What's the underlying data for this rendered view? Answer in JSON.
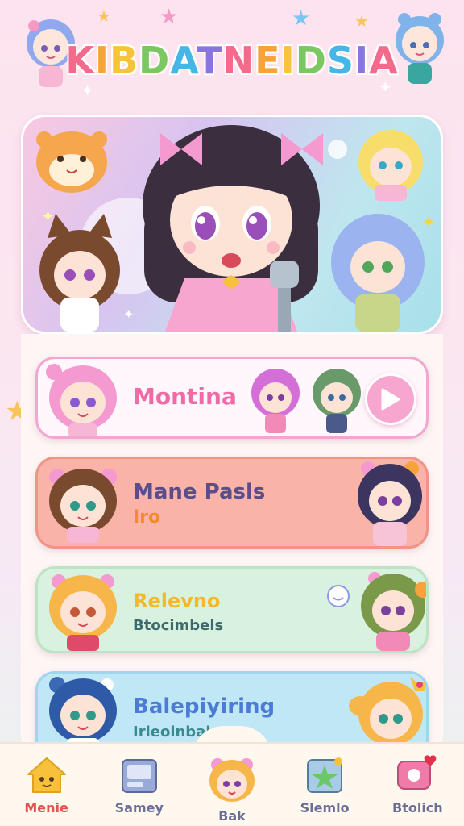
{
  "app": {
    "title_letters": [
      "K",
      "I",
      "B",
      "D",
      "A",
      "T",
      "N",
      "E",
      "I",
      "D",
      "S",
      "I",
      "A"
    ],
    "title_colors": [
      "#f46a8c",
      "#f7a23b",
      "#f5c43a",
      "#7bc862",
      "#45b6e6",
      "#8a74e0",
      "#f46a8c",
      "#f7a23b",
      "#f5c43a",
      "#7bc862",
      "#45b6e6",
      "#8a74e0",
      "#f46a8c"
    ]
  },
  "cards": [
    {
      "title": "Montina",
      "subtitle": "",
      "title_color": "#f06aa8",
      "action": "play"
    },
    {
      "title": "Mane Pasls",
      "subtitle": "Iro",
      "title_color": "#5a4d8a",
      "subtitle_color": "#f58a2c"
    },
    {
      "title": "Relevno",
      "subtitle": "Btocimbels",
      "title_color": "#f5b82a",
      "subtitle_color": "#3d6a6e"
    },
    {
      "title": "Balepiyiring",
      "subtitle": "Irieolnbab",
      "title_color": "#4b7bd6",
      "subtitle_color": "#3a8a8e"
    }
  ],
  "nav": [
    {
      "label": "Menie",
      "icon": "home-icon",
      "active": true
    },
    {
      "label": "Samey",
      "icon": "folder-icon",
      "active": false
    },
    {
      "label": "Bak",
      "icon": "avatar-icon",
      "active": false
    },
    {
      "label": "Slemlo",
      "icon": "star-icon",
      "active": false
    },
    {
      "label": "Btolich",
      "icon": "chat-heart-icon",
      "active": false
    }
  ],
  "colors": {
    "accent_pink": "#f7a7cf",
    "nav_active": "#e0534f",
    "nav_inactive": "#6a6f9a"
  }
}
